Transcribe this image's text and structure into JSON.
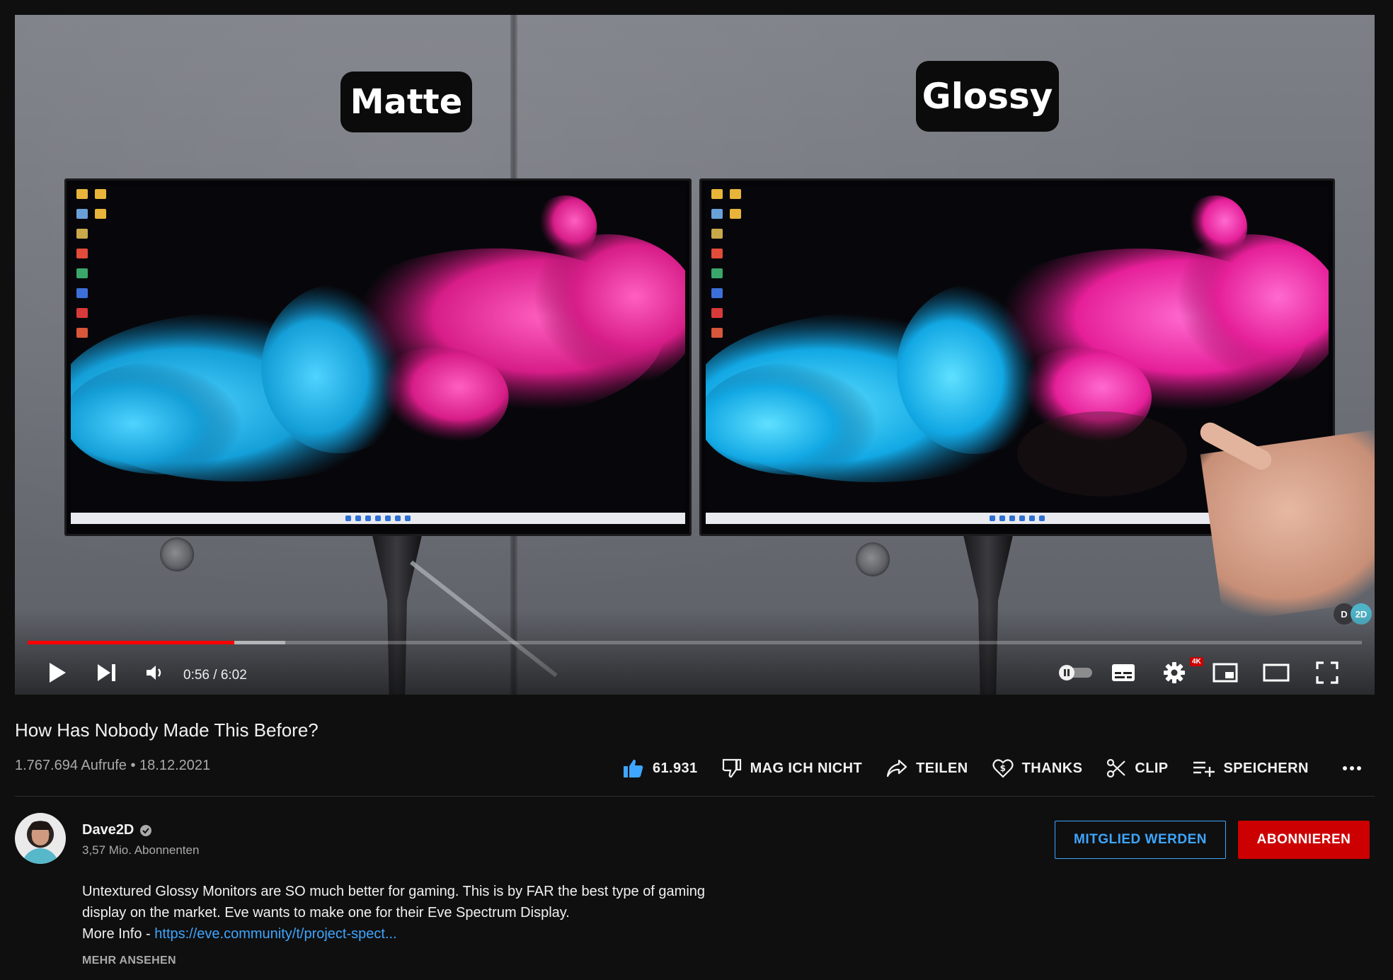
{
  "video": {
    "overlay_left": "Matte",
    "overlay_right": "Glossy",
    "watermark_left": "D",
    "watermark_right": "2D",
    "current_time": "0:56",
    "duration": "6:02",
    "time_display": "0:56 / 6:02",
    "progress_fraction": 0.155,
    "buffer_fraction": 0.193,
    "quality_badge": "4K"
  },
  "meta": {
    "title": "How Has Nobody Made This Before?",
    "stats": "1.767.694 Aufrufe • 18.12.2021"
  },
  "actions": {
    "like_count": "61.931",
    "dislike_label": "MAG ICH NICHT",
    "share_label": "TEILEN",
    "thanks_label": "THANKS",
    "clip_label": "CLIP",
    "save_label": "SPEICHERN"
  },
  "channel": {
    "name": "Dave2D",
    "subscribers": "3,57 Mio. Abonnenten",
    "member_button": "MITGLIED WERDEN",
    "subscribe_button": "ABONNIEREN"
  },
  "description": {
    "line1": "Untextured Glossy Monitors are SO much better for gaming. This is by FAR the best type of gaming",
    "line2": "display on the market. Eve wants to make one for their Eve Spectrum Display.",
    "more_info_prefix": "More Info - ",
    "link_text": "https://eve.community/t/project-spect...",
    "show_more": "MEHR ANSEHEN"
  },
  "colors": {
    "background": "#0f0f0f",
    "accent_red": "#ff0000",
    "link_blue": "#3ea6ff",
    "subscribe_red": "#cc0000",
    "ink_cyan": "#1fb3e6",
    "ink_magenta": "#e8289a",
    "like_blue": "#3ea6ff"
  }
}
